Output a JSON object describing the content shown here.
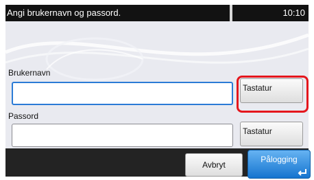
{
  "titlebar": {
    "title": "Angi brukernavn og passord.",
    "clock": "10:10"
  },
  "username": {
    "label": "Brukernavn",
    "value": "",
    "keyboard_button": "Tastatur"
  },
  "password": {
    "label": "Passord",
    "value": "",
    "keyboard_button": "Tastatur"
  },
  "footer": {
    "cancel_label": "Avbryt",
    "login_label": "Pålogging"
  },
  "colors": {
    "accent": "#2b7bd6",
    "highlight": "#e4161d",
    "login": "#1474cf"
  },
  "icons": {
    "login": "enter-icon"
  }
}
